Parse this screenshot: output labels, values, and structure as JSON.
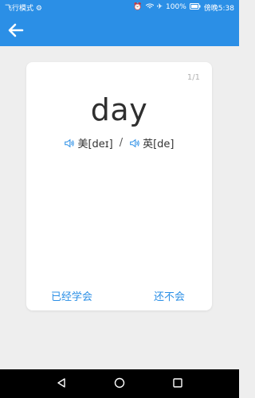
{
  "status_bar": {
    "left": "飞行模式 ⚙",
    "battery": "100%",
    "time": "傍晚5:38"
  },
  "card": {
    "counter": "1/1",
    "word": "day",
    "pronunciations": [
      {
        "label": "美[deɪ]"
      },
      {
        "label": "英[de]"
      }
    ],
    "separator": "/",
    "learned_label": "已经学会",
    "not_learned_label": "还不会"
  },
  "colors": {
    "primary": "#2b8fe6",
    "background": "#eeeeee"
  }
}
